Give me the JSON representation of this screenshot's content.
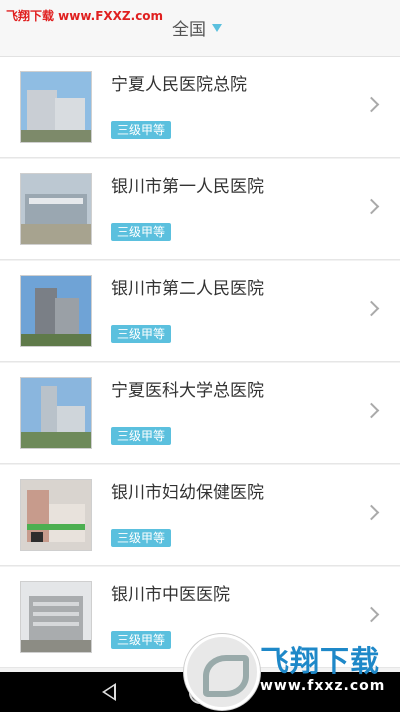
{
  "watermark_top": "飞翔下载 www.FXXZ.com",
  "header": {
    "region_label": "全国"
  },
  "hospitals": [
    {
      "name": "宁夏人民医院总院",
      "level": "三级甲等"
    },
    {
      "name": "银川市第一人民医院",
      "level": "三级甲等"
    },
    {
      "name": "银川市第二人民医院",
      "level": "三级甲等"
    },
    {
      "name": "宁夏医科大学总医院",
      "level": "三级甲等"
    },
    {
      "name": "银川市妇幼保健医院",
      "level": "三级甲等"
    },
    {
      "name": "银川市中医医院",
      "level": "三级甲等"
    }
  ],
  "watermark_bottom": {
    "brand": "飞翔下载",
    "url": "www.fxxz.com"
  },
  "colors": {
    "accent": "#5bc0de",
    "text": "#333333",
    "watermark_red": "#e02020",
    "watermark_blue": "#1e88c8"
  },
  "icons": {
    "row_arrow": "chevron-right-icon",
    "region_dropdown": "caret-down-icon",
    "nav_back": "back-icon",
    "nav_home": "home-icon"
  }
}
